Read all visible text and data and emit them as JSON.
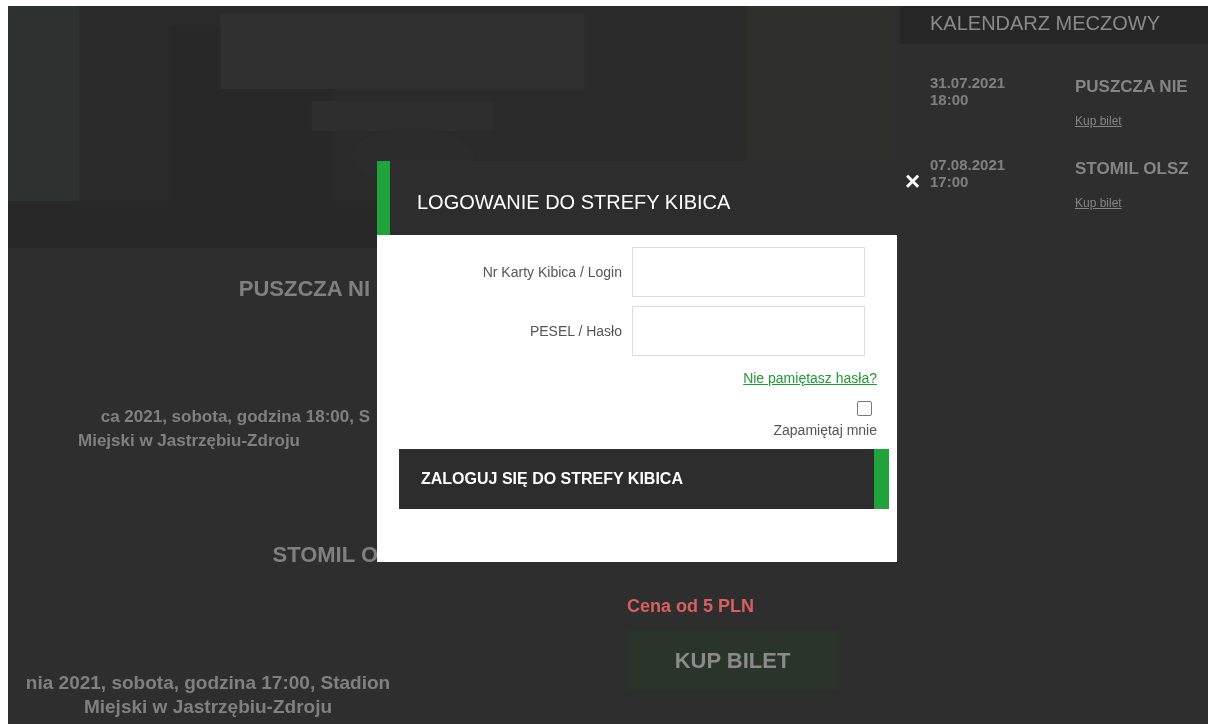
{
  "backdrop": {
    "matches": [
      {
        "title": "PUSZCZA NI",
        "details": [
          "ca 2021, sobota, godzina 18:00, S",
          "Miejski w Jastrzębiu-Zdroju"
        ]
      },
      {
        "title": "STOMIL O",
        "details": [
          "nia 2021, sobota, godzina 17:00, Stadion",
          "Miejski w Jastrzębiu-Zdroju"
        ],
        "price": "Cena od 5 PLN",
        "button": "KUP BILET"
      }
    ],
    "calendar": {
      "title": "KALENDARZ MECZOWY",
      "entries": [
        {
          "date": "31.07.2021",
          "time": "18:00",
          "title": "PUSZCZA NIE",
          "link": "Kup bilet"
        },
        {
          "date": "07.08.2021",
          "time": "17:00",
          "title": "STOMIL OLSZ",
          "link": "Kup bilet"
        }
      ]
    }
  },
  "modal": {
    "title": "LOGOWANIE DO STREFY KIBICA",
    "close": "×",
    "fields": [
      {
        "label": "Nr Karty Kibica / Login"
      },
      {
        "label": "PESEL / Hasło"
      }
    ],
    "forgot_link": "Nie pamiętasz hasła?",
    "remember": {
      "label": "Zapamiętaj mnie",
      "checked": false
    },
    "submit": "ZALOGUJ SIĘ DO STREFY KIBICA"
  }
}
